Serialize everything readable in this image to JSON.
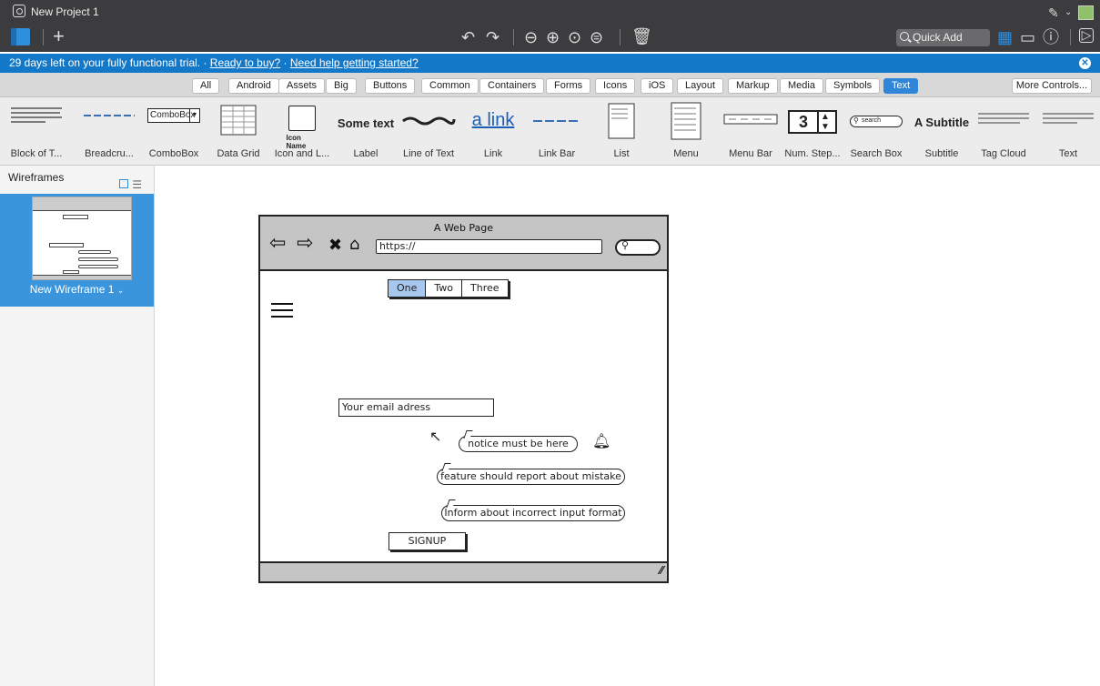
{
  "app": {
    "title": "New Project 1",
    "quick_add": "Quick Add"
  },
  "trial_banner": {
    "text": "29 days left on your fully functional trial. ·",
    "buy_link": "Ready to buy?",
    "help_sep": "·",
    "help_link": "Need help getting started?"
  },
  "categories": [
    "All",
    "Android",
    "Assets",
    "Big",
    "Buttons",
    "Common",
    "Containers",
    "Forms",
    "Icons",
    "iOS",
    "Layout",
    "Markup",
    "Media",
    "Symbols",
    "Text"
  ],
  "active_category": "Text",
  "more_controls": "More Controls...",
  "library": [
    {
      "label": "Block of T..."
    },
    {
      "label": "Breadcru..."
    },
    {
      "label": "ComboBox",
      "preview": "ComboBox"
    },
    {
      "label": "Data Grid"
    },
    {
      "label": "Icon and L...",
      "preview": "Icon Name"
    },
    {
      "label": "Label",
      "preview": "Some text"
    },
    {
      "label": "Line of Text"
    },
    {
      "label": "Link",
      "preview": "a link"
    },
    {
      "label": "Link Bar"
    },
    {
      "label": "List"
    },
    {
      "label": "Menu"
    },
    {
      "label": "Menu Bar"
    },
    {
      "label": "Num. Step...",
      "preview": "3"
    },
    {
      "label": "Search Box",
      "preview": "search"
    },
    {
      "label": "Subtitle",
      "preview": "A Subtitle"
    },
    {
      "label": "Tag Cloud"
    },
    {
      "label": "Text"
    }
  ],
  "left_panel": {
    "title": "Wireframes",
    "wireframe_name": "New Wireframe 1"
  },
  "wireframe": {
    "title": "A Web Page",
    "url": "https://",
    "tabs": [
      "One",
      "Two",
      "Three"
    ],
    "selected_tab": "One",
    "email_placeholder": "Your email adress",
    "notice": "notice must be here",
    "feature": "feature should report about mistake",
    "inform": "Inform about incorrect input format",
    "signup": "SIGNUP"
  }
}
